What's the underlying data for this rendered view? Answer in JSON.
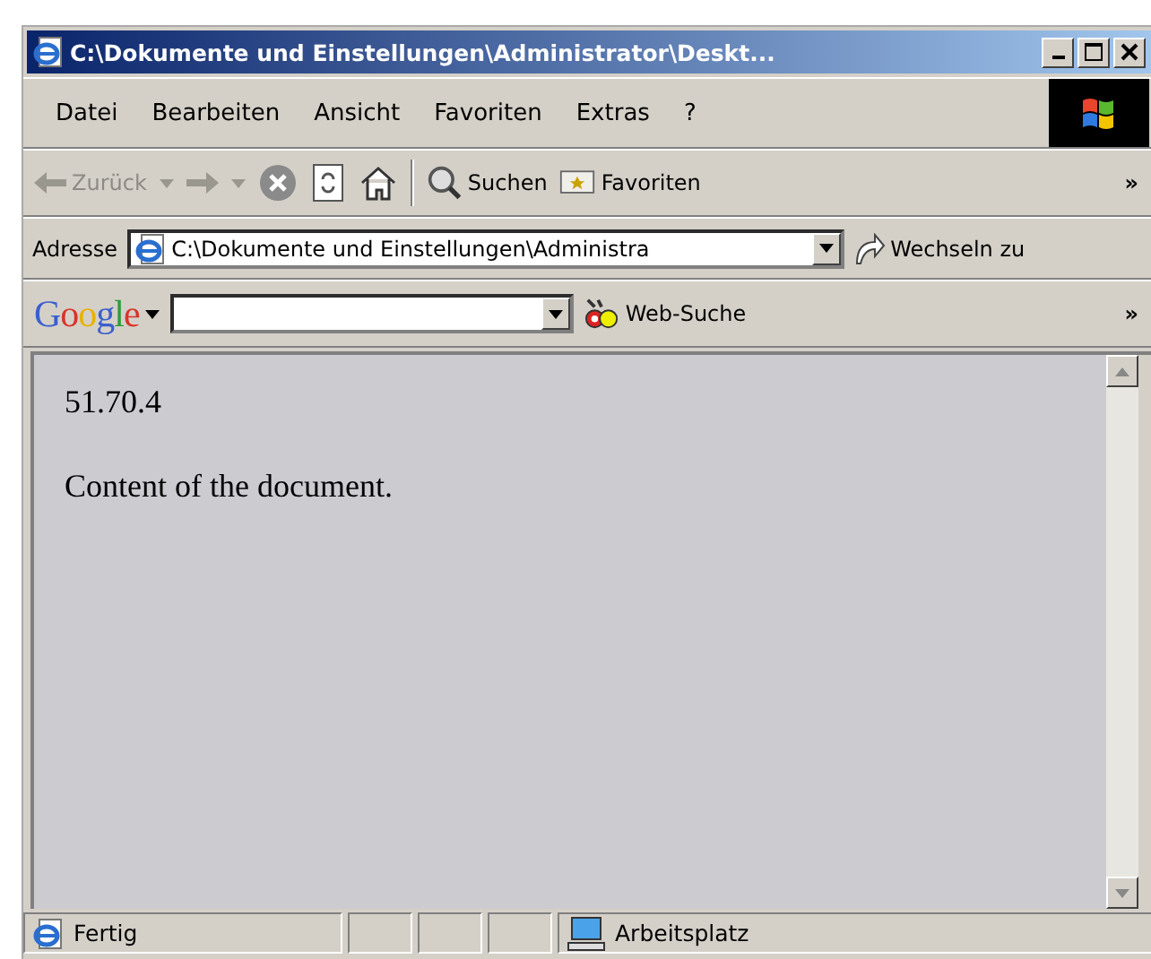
{
  "window": {
    "title": "C:\\Dokumente und Einstellungen\\Administrator\\Deskt..."
  },
  "menu": [
    "Datei",
    "Bearbeiten",
    "Ansicht",
    "Favoriten",
    "Extras",
    "?"
  ],
  "toolbar": {
    "back": "Zurück",
    "search": "Suchen",
    "favorites": "Favoriten",
    "more": "»"
  },
  "address_bar": {
    "label": "Adresse",
    "value": "C:\\Dokumente und Einstellungen\\Administra",
    "go": "Wechseln zu"
  },
  "google_bar": {
    "logo": "Google",
    "search_button": "Web-Suche",
    "more": "»"
  },
  "document": {
    "lines": [
      "51.70.4",
      "Content of the document."
    ]
  },
  "status_bar": {
    "status": "Fertig",
    "zone": "Arbeitsplatz"
  }
}
